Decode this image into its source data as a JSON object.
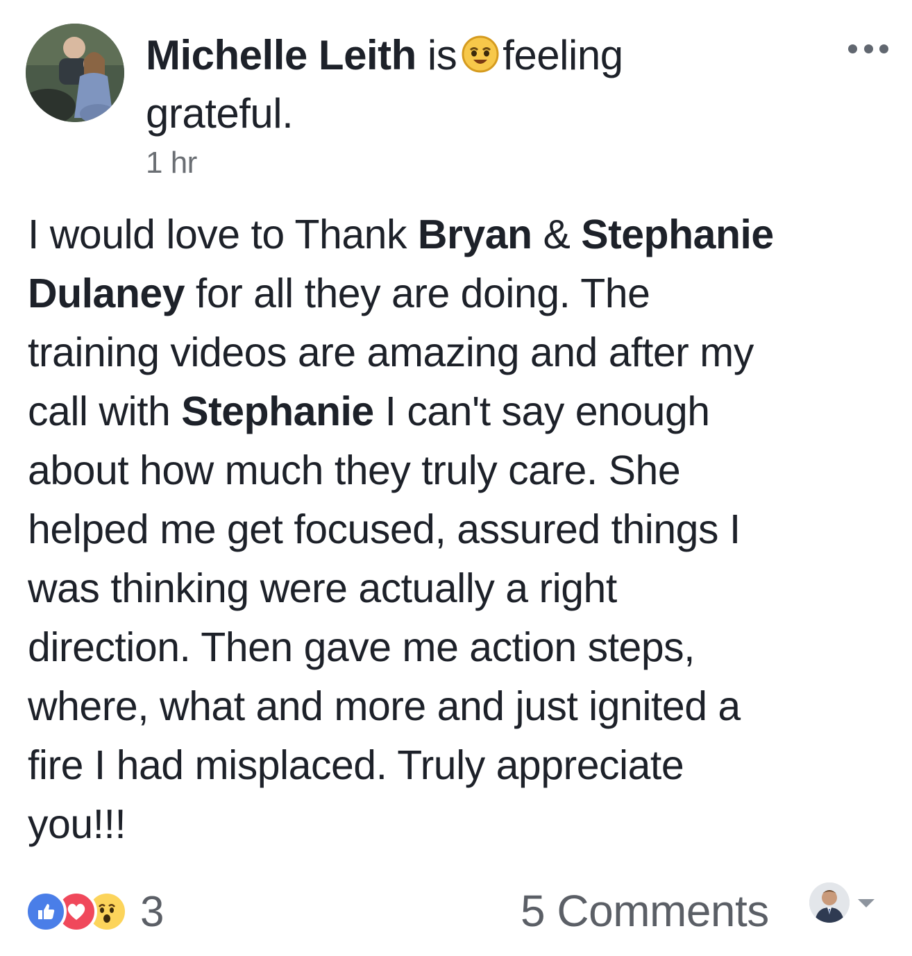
{
  "header": {
    "author_name": "Michelle Leith",
    "is_text": "is",
    "feeling_icon": "grateful-face-emoji",
    "feeling_text_1": "feeling",
    "feeling_text_2": "grateful.",
    "timestamp": "1 hr",
    "more_icon": "more-horizontal-icon"
  },
  "body": {
    "lines": [
      [
        "I would love to Thank ",
        "Bryan",
        " & ",
        "Stephanie"
      ],
      [
        "Dulaney",
        " for all they are doing. The"
      ],
      [
        "training videos are amazing and after my"
      ],
      [
        "call with ",
        "Stephanie",
        " I can't say enough"
      ],
      [
        "about how much they truly care. She"
      ],
      [
        "helped me get focused, assured things I"
      ],
      [
        "was thinking were actually a right"
      ],
      [
        "direction. Then gave me action steps,"
      ],
      [
        "where, what and more and just ignited a"
      ],
      [
        "fire I had misplaced. Truly appreciate"
      ],
      [
        "you!!!"
      ]
    ]
  },
  "footer": {
    "reactions": [
      "like-icon",
      "love-icon",
      "wow-icon"
    ],
    "reaction_count": "3",
    "comments_label": "5 Comments",
    "audience_icon": "profile-avatar-icon",
    "caret_icon": "caret-down-icon"
  },
  "colors": {
    "text": "#1d2129",
    "secondary": "#6a6e73",
    "like": "#4a7ee8",
    "love": "#f0485b",
    "wow": "#fcd45b"
  }
}
